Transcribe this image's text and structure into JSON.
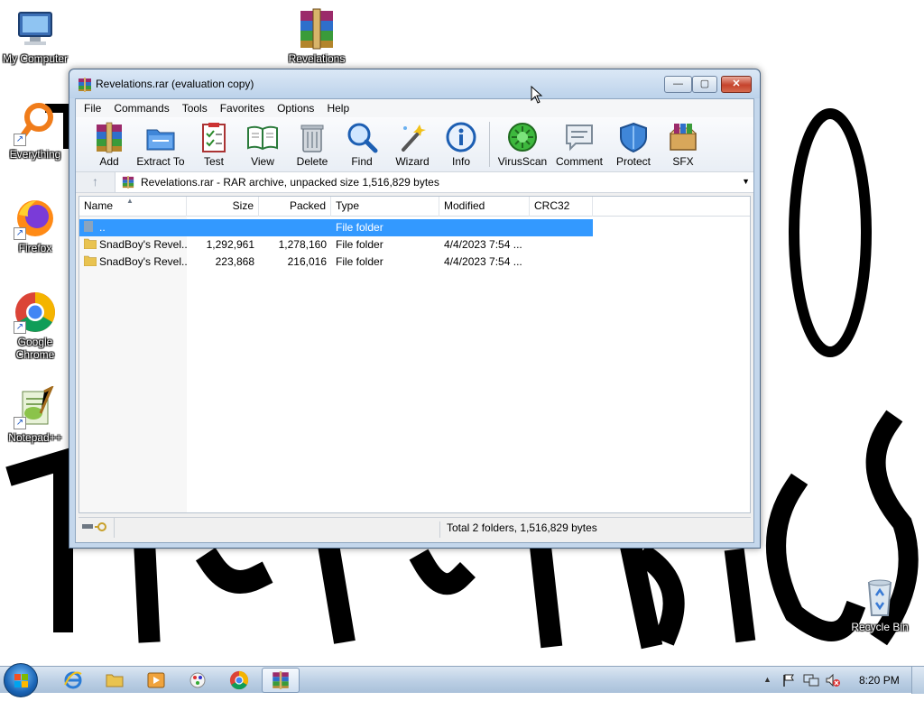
{
  "desktop": {
    "icons": [
      {
        "label": "My Computer",
        "icon": "computer-icon"
      },
      {
        "label": "Revelations",
        "icon": "winrar-archive-icon"
      },
      {
        "label": "Everything",
        "icon": "everything-search-icon"
      },
      {
        "label": "Firefox",
        "icon": "firefox-icon"
      },
      {
        "label": "Google Chrome",
        "icon": "chrome-icon"
      },
      {
        "label": "Notepad++",
        "icon": "notepadpp-icon"
      },
      {
        "label": "Recycle Bin",
        "icon": "recycle-bin-icon"
      }
    ]
  },
  "window": {
    "title": "Revelations.rar (evaluation copy)",
    "controls": {
      "minimize": "—",
      "maximize": "▢",
      "close": "✕"
    },
    "menu": [
      "File",
      "Commands",
      "Tools",
      "Favorites",
      "Options",
      "Help"
    ],
    "toolbar": [
      {
        "label": "Add",
        "icon": "add-archive-icon"
      },
      {
        "label": "Extract To",
        "icon": "extract-to-icon"
      },
      {
        "label": "Test",
        "icon": "test-icon"
      },
      {
        "label": "View",
        "icon": "view-book-icon"
      },
      {
        "label": "Delete",
        "icon": "delete-trash-icon"
      },
      {
        "label": "Find",
        "icon": "find-magnifier-icon"
      },
      {
        "label": "Wizard",
        "icon": "wizard-wand-icon"
      },
      {
        "label": "Info",
        "icon": "info-icon"
      },
      {
        "label": "VirusScan",
        "icon": "virus-scan-icon"
      },
      {
        "label": "Comment",
        "icon": "comment-icon"
      },
      {
        "label": "Protect",
        "icon": "protect-shield-icon"
      },
      {
        "label": "SFX",
        "icon": "sfx-box-icon"
      }
    ],
    "address": {
      "up_arrow": "↑",
      "path": "Revelations.rar - RAR archive, unpacked size 1,516,829 bytes",
      "dropdown": "▼"
    },
    "columns": [
      "Name",
      "Size",
      "Packed",
      "Type",
      "Modified",
      "CRC32"
    ],
    "sort_indicator": "▲",
    "rows": [
      {
        "name": "..",
        "size": "",
        "packed": "",
        "type": "File folder",
        "modified": "",
        "crc": "",
        "selected": true
      },
      {
        "name": "SnadBoy's Revel...",
        "size": "1,292,961",
        "packed": "1,278,160",
        "type": "File folder",
        "modified": "4/4/2023 7:54 ...",
        "crc": "",
        "selected": false
      },
      {
        "name": "SnadBoy's Revel...",
        "size": "223,868",
        "packed": "216,016",
        "type": "File folder",
        "modified": "4/4/2023 7:54 ...",
        "crc": "",
        "selected": false
      }
    ],
    "status": "Total 2 folders, 1,516,829 bytes"
  },
  "taskbar": {
    "items": [
      "internet-explorer-icon",
      "file-explorer-icon",
      "media-player-icon",
      "paint-icon",
      "chrome-icon",
      "winrar-icon"
    ],
    "tray_arrow": "▲",
    "clock": "8:20 PM"
  },
  "colors": {
    "selection": "#3399ff",
    "title_bar": "#c4d7ec",
    "close_button": "#c5432c",
    "taskbar": "#b9cde3"
  }
}
